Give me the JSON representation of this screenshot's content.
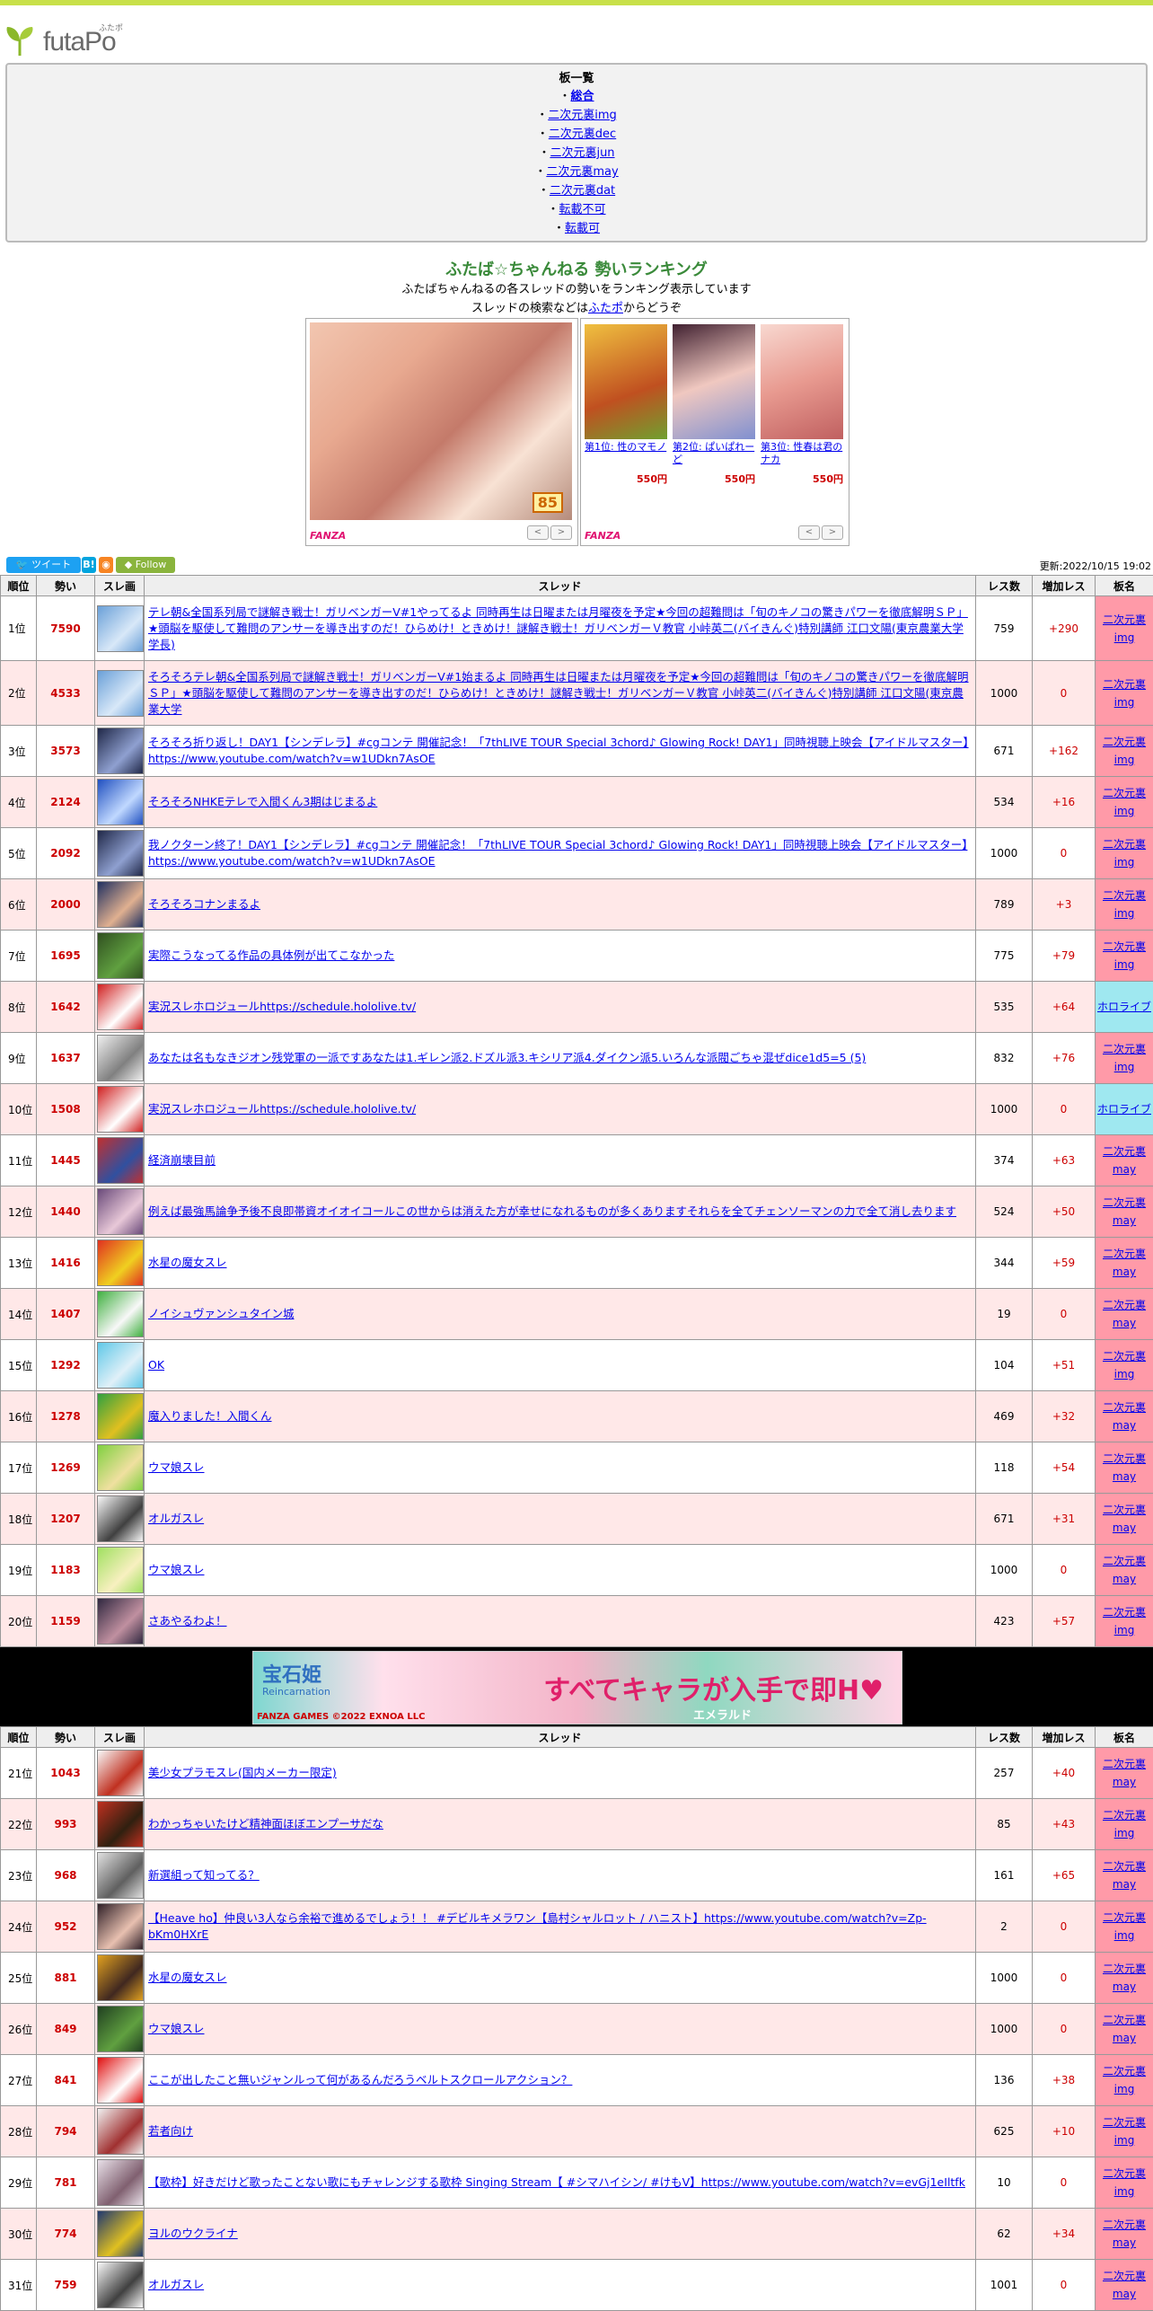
{
  "site": {
    "logo": "futaPo",
    "logo_ruby": "ふたポ"
  },
  "boards": {
    "heading": "板一覧",
    "items": [
      {
        "label": "総合",
        "current": true
      },
      {
        "label": "二次元裏img"
      },
      {
        "label": "二次元裏dec"
      },
      {
        "label": "二次元裏jun"
      },
      {
        "label": "二次元裏may"
      },
      {
        "label": "二次元裏dat"
      },
      {
        "label": "転載不可"
      },
      {
        "label": "転載可"
      }
    ]
  },
  "page_title": "ふたば☆ちゃんねる 勢いランキング",
  "description": {
    "line1": "ふたばちゃんねるの各スレッドの勢いをランキング表示しています",
    "line2_pre": "スレッドの検索などは",
    "line2_link": "ふたポ",
    "line2_post": "からどうぞ"
  },
  "ads": {
    "ad1": {
      "badge": "85",
      "brand": "FANZA"
    },
    "ad2": {
      "brand": "FANZA",
      "items": [
        {
          "name": "第1位: 性のマモノ",
          "price": "550円"
        },
        {
          "name": "第2位: ぱいぱれーど",
          "price": "550円"
        },
        {
          "name": "第3位: 性春は君のナカ",
          "price": "550円"
        }
      ]
    },
    "prev": "<",
    "next": ">"
  },
  "social": {
    "tweet": "ツイート",
    "hatena": "B!",
    "follow": "Follow"
  },
  "updated": "更新:2022/10/15 19:02",
  "table": {
    "headers": [
      "順位",
      "勢い",
      "スレ画",
      "スレッド",
      "レス数",
      "増加レス",
      "板名"
    ],
    "rows": [
      {
        "rank": "1位",
        "ikioi": "7590",
        "title": "テレ朝&全国系列局で謎解き戦士！ガリベンガーV#1やってるよ 同時再生は日曜または月曜夜を予定★今回の超難問は「旬のキノコの驚きパワーを徹底解明ＳＰ」★頭脳を駆使して難問のアンサーを導き出すのだ！ひらめけ！ときめけ！謎解き戦士！ガリベンガーＶ教官 小峠英二(バイきんぐ)特別講師 江口文陽(東京農業大学 学長)",
        "res": "759",
        "inc": "+290",
        "board": "二次元裏img",
        "btype": "nijiura",
        "img": [
          "#6aa0d8",
          "#d8e8f8"
        ]
      },
      {
        "rank": "2位",
        "ikioi": "4533",
        "title": "そろそろテレ朝&全国系列局で謎解き戦士！ガリベンガーV#1始まるよ 同時再生は日曜または月曜夜を予定★今回の超難問は「旬のキノコの驚きパワーを徹底解明ＳＰ」★頭脳を駆使して難問のアンサーを導き出すのだ！ひらめけ！ときめけ！謎解き戦士！ガリベンガーＶ教官 小峠英二(バイきんぐ)特別講師 江口文陽(東京農業大学",
        "res": "1000",
        "inc": "0",
        "board": "二次元裏img",
        "btype": "nijiura",
        "img": [
          "#6aa0d8",
          "#d8e8f8"
        ]
      },
      {
        "rank": "3位",
        "ikioi": "3573",
        "title": "そろそろ折り返し！DAY1【シンデレラ】#cgコンテ 開催記念！「7thLIVE TOUR Special 3chord♪ Glowing Rock! DAY1」同時視聴上映会【アイドルマスター】https://www.youtube.com/watch?v=w1UDkn7AsOE",
        "res": "671",
        "inc": "+162",
        "board": "二次元裏img",
        "btype": "nijiura",
        "img": [
          "#202848",
          "#8fa0d0"
        ]
      },
      {
        "rank": "4位",
        "ikioi": "2124",
        "title": "そろそろNHKEテレで入間くん3期はじまるよ",
        "res": "534",
        "inc": "+16",
        "board": "二次元裏img",
        "btype": "nijiura",
        "img": [
          "#2050c0",
          "#c0d8ff"
        ]
      },
      {
        "rank": "5位",
        "ikioi": "2092",
        "title": "我ノクターン終了！DAY1【シンデレラ】#cgコンテ 開催記念！「7thLIVE TOUR Special 3chord♪ Glowing Rock! DAY1」同時視聴上映会【アイドルマスター】https://www.youtube.com/watch?v=w1UDkn7AsOE",
        "res": "1000",
        "inc": "0",
        "board": "二次元裏img",
        "btype": "nijiura",
        "img": [
          "#202848",
          "#8fa0d0"
        ]
      },
      {
        "rank": "6位",
        "ikioi": "2000",
        "title": "そろそろコナンまるよ",
        "res": "789",
        "inc": "+3",
        "board": "二次元裏img",
        "btype": "nijiura",
        "img": [
          "#203060",
          "#e0b090"
        ]
      },
      {
        "rank": "7位",
        "ikioi": "1695",
        "title": "実際こうなってる作品の具体例が出てこなかった",
        "res": "775",
        "inc": "+79",
        "board": "二次元裏img",
        "btype": "nijiura",
        "img": [
          "#305020",
          "#60a040"
        ]
      },
      {
        "rank": "8位",
        "ikioi": "1642",
        "title": "実況スレホロジュールhttps://schedule.hololive.tv/",
        "res": "535",
        "inc": "+64",
        "board": "ホロライブ",
        "btype": "holo",
        "img": [
          "#d02020",
          "#ffffff"
        ]
      },
      {
        "rank": "9位",
        "ikioi": "1637",
        "title": "あなたは名もなきジオン残党軍の一派ですあなたは1.ギレン派2.ドズル派3.キシリア派4.ダイクン派5.いろんな派閥ごちゃ混ぜdice1d5=5 (5)",
        "res": "832",
        "inc": "+76",
        "board": "二次元裏img",
        "btype": "nijiura",
        "img": [
          "#f0f0f0",
          "#808080"
        ]
      },
      {
        "rank": "10位",
        "ikioi": "1508",
        "title": "実況スレホロジュールhttps://schedule.hololive.tv/",
        "res": "1000",
        "inc": "0",
        "board": "ホロライブ",
        "btype": "holo",
        "img": [
          "#d02020",
          "#ffffff"
        ]
      },
      {
        "rank": "11位",
        "ikioi": "1445",
        "title": "経済崩壊目前",
        "res": "374",
        "inc": "+63",
        "board": "二次元裏may",
        "btype": "nijiura",
        "img": [
          "#c03030",
          "#3050a0"
        ]
      },
      {
        "rank": "12位",
        "ikioi": "1440",
        "title": "例えば最強馬論争予後不良即帯資オイオイコールこの世からは消えた方が幸せになれるものが多くありますそれらを全てチェンソーマンの力で全て消し去ります",
        "res": "524",
        "inc": "+50",
        "board": "二次元裏may",
        "btype": "nijiura",
        "img": [
          "#6a4a7a",
          "#e8c8d8"
        ]
      },
      {
        "rank": "13位",
        "ikioi": "1416",
        "title": "水星の魔女スレ",
        "res": "344",
        "inc": "+59",
        "board": "二次元裏may",
        "btype": "nijiura",
        "img": [
          "#e03020",
          "#f0d020"
        ]
      },
      {
        "rank": "14位",
        "ikioi": "1407",
        "title": "ノイシュヴァンシュタイン城",
        "res": "19",
        "inc": "0",
        "board": "二次元裏may",
        "btype": "nijiura",
        "img": [
          "#40b040",
          "#f8f8f8"
        ]
      },
      {
        "rank": "15位",
        "ikioi": "1292",
        "title": "OK",
        "res": "104",
        "inc": "+51",
        "board": "二次元裏img",
        "btype": "nijiura",
        "img": [
          "#60c8e8",
          "#e0f0f8"
        ]
      },
      {
        "rank": "16位",
        "ikioi": "1278",
        "title": "魔入りました！入間くん",
        "res": "469",
        "inc": "+32",
        "board": "二次元裏may",
        "btype": "nijiura",
        "img": [
          "#30a040",
          "#e0c020"
        ]
      },
      {
        "rank": "17位",
        "ikioi": "1269",
        "title": "ウマ娘スレ",
        "res": "118",
        "inc": "+54",
        "board": "二次元裏may",
        "btype": "nijiura",
        "img": [
          "#80d040",
          "#f0e0a0"
        ]
      },
      {
        "rank": "18位",
        "ikioi": "1207",
        "title": "オルガスレ",
        "res": "671",
        "inc": "+31",
        "board": "二次元裏may",
        "btype": "nijiura",
        "img": [
          "#f8f8f8",
          "#404040"
        ]
      },
      {
        "rank": "19位",
        "ikioi": "1183",
        "title": "ウマ娘スレ",
        "res": "1000",
        "inc": "0",
        "board": "二次元裏may",
        "btype": "nijiura",
        "img": [
          "#a0e060",
          "#f8f0c0"
        ]
      },
      {
        "rank": "20位",
        "ikioi": "1159",
        "title": "さあやるわよ！",
        "res": "423",
        "inc": "+57",
        "board": "二次元裏img",
        "btype": "nijiura",
        "img": [
          "#302840",
          "#c090a0"
        ]
      }
    ],
    "rows2": [
      {
        "rank": "21位",
        "ikioi": "1043",
        "title": "美少女プラモスレ(国内メーカー限定)",
        "res": "257",
        "inc": "+40",
        "board": "二次元裏may",
        "btype": "nijiura",
        "img": [
          "#f8f8f8",
          "#c03020"
        ]
      },
      {
        "rank": "22位",
        "ikioi": "993",
        "title": "わかっちゃいたけど精神面ほぼエンプーサだな",
        "res": "85",
        "inc": "+43",
        "board": "二次元裏img",
        "btype": "nijiura",
        "img": [
          "#c03020",
          "#302010"
        ]
      },
      {
        "rank": "23位",
        "ikioi": "968",
        "title": "新選組って知ってる？",
        "res": "161",
        "inc": "+65",
        "board": "二次元裏may",
        "btype": "nijiura",
        "img": [
          "#e0e0e0",
          "#606060"
        ]
      },
      {
        "rank": "24位",
        "ikioi": "952",
        "title": "【Heave ho】仲良い3人なら余裕で進めるでしょう！！ #デビルキメラワン【島村シャルロット / ハニスト】https://www.youtube.com/watch?v=Zp-bKm0HXrE",
        "res": "2",
        "inc": "0",
        "board": "二次元裏img",
        "btype": "nijiura",
        "img": [
          "#302028",
          "#e8c0b0"
        ]
      },
      {
        "rank": "25位",
        "ikioi": "881",
        "title": "水星の魔女スレ",
        "res": "1000",
        "inc": "0",
        "board": "二次元裏may",
        "btype": "nijiura",
        "img": [
          "#e0a020",
          "#402820"
        ]
      },
      {
        "rank": "26位",
        "ikioi": "849",
        "title": "ウマ娘スレ",
        "res": "1000",
        "inc": "0",
        "board": "二次元裏may",
        "btype": "nijiura",
        "img": [
          "#204020",
          "#60a040"
        ]
      },
      {
        "rank": "27位",
        "ikioi": "841",
        "title": "ここが出したこと無いジャンルって何があるんだろうベルトスクロールアクション？",
        "res": "136",
        "inc": "+38",
        "board": "二次元裏img",
        "btype": "nijiura",
        "img": [
          "#e01010",
          "#ffffff"
        ]
      },
      {
        "rank": "28位",
        "ikioi": "794",
        "title": "若者向け",
        "res": "625",
        "inc": "+10",
        "board": "二次元裏img",
        "btype": "nijiura",
        "img": [
          "#f0f0f0",
          "#a03030"
        ]
      },
      {
        "rank": "29位",
        "ikioi": "781",
        "title": "【歌枠】好きだけど歌ったことない歌にもチャレンジする歌枠 Singing Stream【 #シマハイシン/ #けもV】https://www.youtube.com/watch?v=evGj1eIltfk",
        "res": "10",
        "inc": "0",
        "board": "二次元裏img",
        "btype": "nijiura",
        "img": [
          "#e8e0e8",
          "#806070"
        ]
      },
      {
        "rank": "30位",
        "ikioi": "774",
        "title": "ヨルのウクライナ",
        "res": "62",
        "inc": "+34",
        "board": "二次元裏may",
        "btype": "nijiura",
        "img": [
          "#203870",
          "#e0c020"
        ]
      },
      {
        "rank": "31位",
        "ikioi": "759",
        "title": "オルガスレ",
        "res": "1001",
        "inc": "0",
        "board": "二次元裏may",
        "btype": "nijiura",
        "img": [
          "#f8f8f8",
          "#404040"
        ]
      }
    ]
  },
  "banner": {
    "title": "宝石姫",
    "subtitle": "Reincarnation",
    "catch": "すべてキャラが入手で即H♥",
    "brand": "FANZA GAMES ©2022 EXNOA LLC",
    "name": "エメラルド"
  },
  "colors": {
    "accent_bar": "#c8e04a",
    "board_nijiura": "#ff9aa8",
    "board_holo": "#9fe8f0",
    "row_alt": "#ffe8e8",
    "ikioi": "#cc0000"
  }
}
